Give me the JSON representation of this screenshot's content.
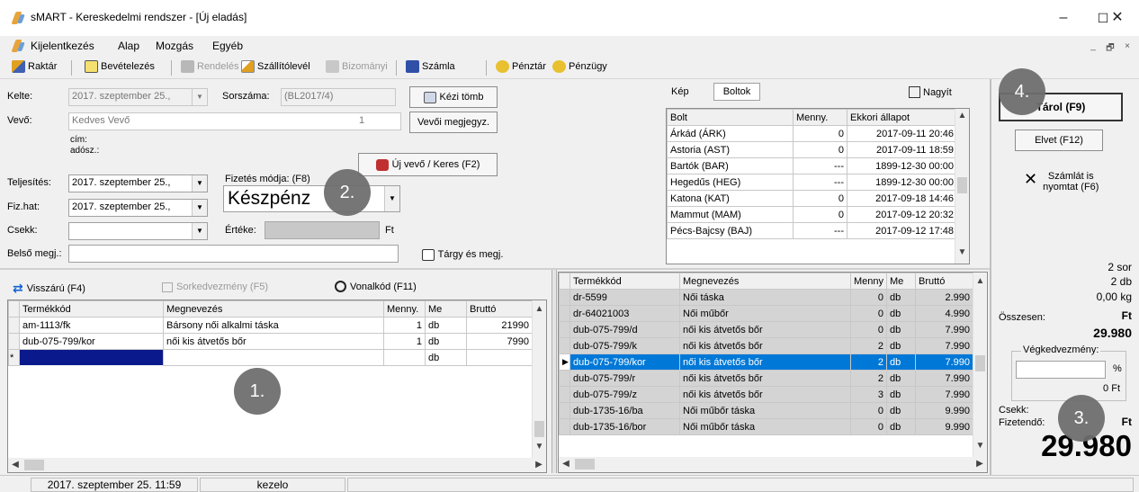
{
  "window": {
    "title": "sMART  -  Kereskedelmi rendszer - [Új eladás]",
    "minimize": "–",
    "maximize": "☐",
    "close": "✕"
  },
  "menu": [
    "Kijelentkezés",
    "Alap",
    "Mozgás",
    "Egyéb"
  ],
  "mdi": {
    "minimize": "_",
    "restore": "🗗",
    "close": "×"
  },
  "toolbar": {
    "raktar": "Raktár",
    "bevetelezes": "Bevételezés",
    "rendeles": "Rendelés",
    "szallitolevel": "Szállítólevél",
    "bizomanyi": "Bizományi",
    "szamla": "Számla",
    "penztar": "Pénztár",
    "penzugy": "Pénzügy"
  },
  "form": {
    "kelte_label": "Kelte:",
    "kelte_value": "2017. szeptember 25.,",
    "sorszama_label": "Sorszáma:",
    "sorszama_value": "(BL2017/4)",
    "kezi_tomb": "Kézi tömb",
    "vevo_label": "Vevő:",
    "vevo_value": "Kedves Vevő",
    "vevo_num": "1",
    "vevoi_megjegyz": "Vevői megjegyz.",
    "cim_label": "cím:",
    "adosz_label": "adósz.:",
    "uj_vevo": "Új vevő / Keres (F2)",
    "teljesites_label": "Teljesítés:",
    "teljesites_value": "2017. szeptember 25.,",
    "fizhat_label": "Fiz.hat:",
    "fizhat_value": "2017. szeptember 25.,",
    "fizetes_modja_label": "Fizetés módja: (F8)",
    "fizetes_modja_value": "Készpénz",
    "csekk_label": "Csekk:",
    "csekk_value": "",
    "erteke_label": "Értéke:",
    "ft_label": "Ft",
    "belso_megj_label": "Belső megj.:",
    "belso_megj_value": "",
    "targy_megj": "Tárgy és megj."
  },
  "shops": {
    "tab_kep": "Kép",
    "tab_boltok": "Boltok",
    "nagyit": "Nagyít",
    "headers": [
      "Bolt",
      "Menny.",
      "Ekkori állapot"
    ],
    "rows": [
      [
        "Árkád (ÁRK)",
        "0",
        "2017-09-11  20:46"
      ],
      [
        "Astoria (AST)",
        "0",
        "2017-09-11  18:59"
      ],
      [
        "Bartók (BAR)",
        "---",
        "1899-12-30  00:00"
      ],
      [
        "Hegedűs (HEG)",
        "---",
        "1899-12-30  00:00"
      ],
      [
        "Katona (KAT)",
        "0",
        "2017-09-18  14:46"
      ],
      [
        "Mammut (MAM)",
        "0",
        "2017-09-12  20:32"
      ],
      [
        "Pécs-Bajcsy (BAJ)",
        "---",
        "2017-09-12  17:48"
      ]
    ]
  },
  "actions": {
    "tarol": "Tárol (F9)",
    "elvet": "Elvet (F12)",
    "szamlat": "Számlát is",
    "nyomtat": "nyomtat  (F6)"
  },
  "cart_toolbar": {
    "visszaru": "Visszárú (F4)",
    "sorkedvezmeny": "Sorkedvezmény (F5)",
    "vonalkod": "Vonalkód (F11)"
  },
  "cart": {
    "headers": [
      "Termékkód",
      "Megnevezés",
      "Menny.",
      "Me",
      "Bruttó"
    ],
    "rows": [
      [
        "am-1113/fk",
        "Bársony női alkalmi táska",
        "1",
        "db",
        "21990"
      ],
      [
        "dub-075-799/kor",
        "női kis átvetős bőr",
        "1",
        "db",
        "7990"
      ],
      [
        "",
        "",
        "",
        "db",
        ""
      ]
    ],
    "new_row_marker": "*"
  },
  "products": {
    "headers": [
      "Termékkód",
      "Megnevezés",
      "Menny",
      "Me",
      "Bruttó"
    ],
    "rows": [
      [
        "dr-5599",
        "Női táska",
        "0",
        "db",
        "2.990"
      ],
      [
        "dr-64021003",
        "Női műbőr",
        "0",
        "db",
        "4.990"
      ],
      [
        "dub-075-799/d",
        "női kis átvetős bőr",
        "0",
        "db",
        "7.990"
      ],
      [
        "dub-075-799/k",
        "női kis átvetős bőr",
        "2",
        "db",
        "7.990"
      ],
      [
        "dub-075-799/kor",
        "női kis átvetős bőr",
        "2",
        "db",
        "7.990"
      ],
      [
        "dub-075-799/r",
        "női kis átvetős bőr",
        "2",
        "db",
        "7.990"
      ],
      [
        "dub-075-799/z",
        "női kis átvetős bőr",
        "3",
        "db",
        "7.990"
      ],
      [
        "dub-1735-16/ba",
        "Női műbőr táska",
        "0",
        "db",
        "9.990"
      ],
      [
        "dub-1735-16/bor",
        "Női műbőr táska",
        "0",
        "db",
        "9.990"
      ]
    ],
    "selected_index": 4
  },
  "summary": {
    "sor": "2 sor",
    "db": "2 db",
    "kg": "0,00 kg",
    "osszesen_label": "Összesen:",
    "osszesen_ft": "Ft",
    "osszesen_value": "29.980",
    "vegkedvezmeny_label": "Végkedvezmény:",
    "percent": "%",
    "disc_ft": "0 Ft",
    "csekk_label": "Csekk:",
    "fizetendo_label": "Fizetendő:",
    "fizetendo_ft": "Ft",
    "fizetendo_value": "29.980"
  },
  "callouts": [
    "1.",
    "2.",
    "3.",
    "4."
  ],
  "status": {
    "datetime": "2017. szeptember 25.  11:59",
    "user": "kezelo"
  }
}
